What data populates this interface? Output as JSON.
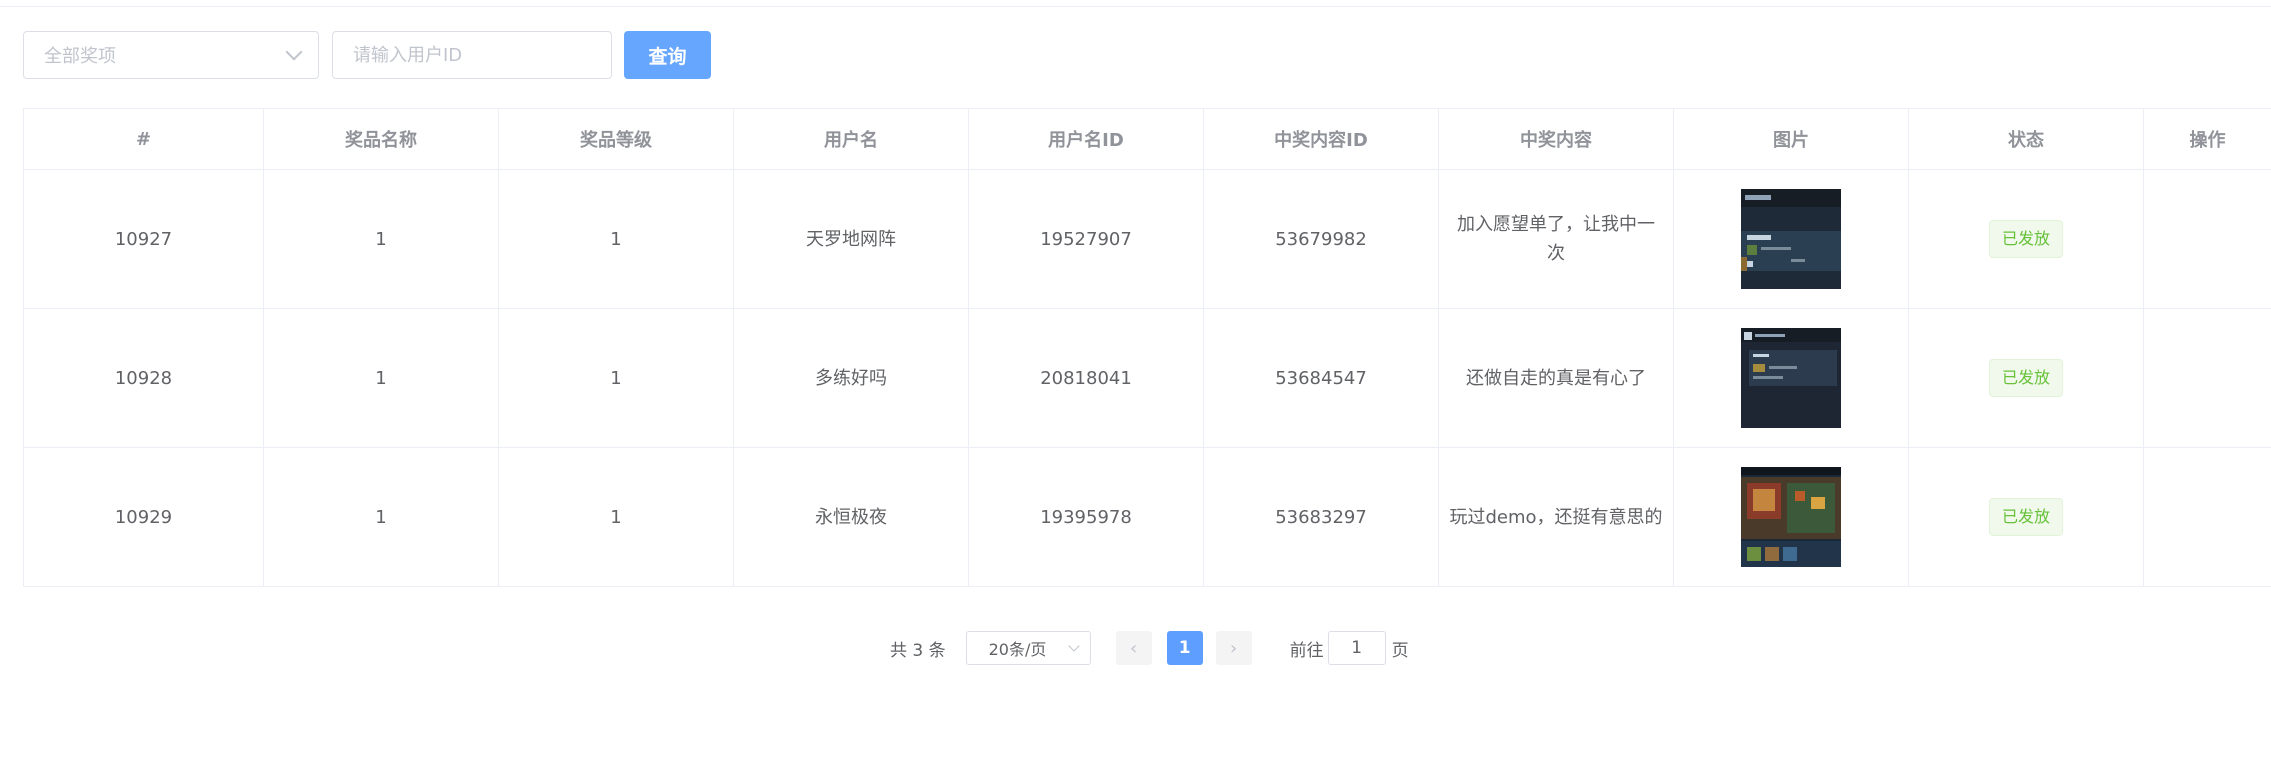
{
  "filters": {
    "prize_select": "全部奖项",
    "user_id_placeholder": "请输入用户ID",
    "query_button": "查询"
  },
  "table": {
    "columns": [
      "#",
      "奖品名称",
      "奖品等级",
      "用户名",
      "用户名ID",
      "中奖内容ID",
      "中奖内容",
      "图片",
      "状态",
      "操作"
    ],
    "rows": [
      {
        "id": "10927",
        "prize_name": "1",
        "prize_level": "1",
        "username": "天罗地网阵",
        "user_id": "19527907",
        "content_id": "53679982",
        "content": "加入愿望单了，让我中一次",
        "status": "已发放"
      },
      {
        "id": "10928",
        "prize_name": "1",
        "prize_level": "1",
        "username": "多练好吗",
        "user_id": "20818041",
        "content_id": "53684547",
        "content": "还做自走的真是有心了",
        "status": "已发放"
      },
      {
        "id": "10929",
        "prize_name": "1",
        "prize_level": "1",
        "username": "永恒极夜",
        "user_id": "19395978",
        "content_id": "53683297",
        "content": "玩过demo，还挺有意思的",
        "status": "已发放"
      }
    ]
  },
  "pagination": {
    "total": "共 3 条",
    "page_size": "20条/页",
    "prev": "‹",
    "current_page": "1",
    "next": "›",
    "goto_label": "前往",
    "goto_value": "1",
    "goto_suffix": "页"
  },
  "colors": {
    "primary": "#66a6ff",
    "success": "#67c23a",
    "border": "#ebeef5"
  }
}
